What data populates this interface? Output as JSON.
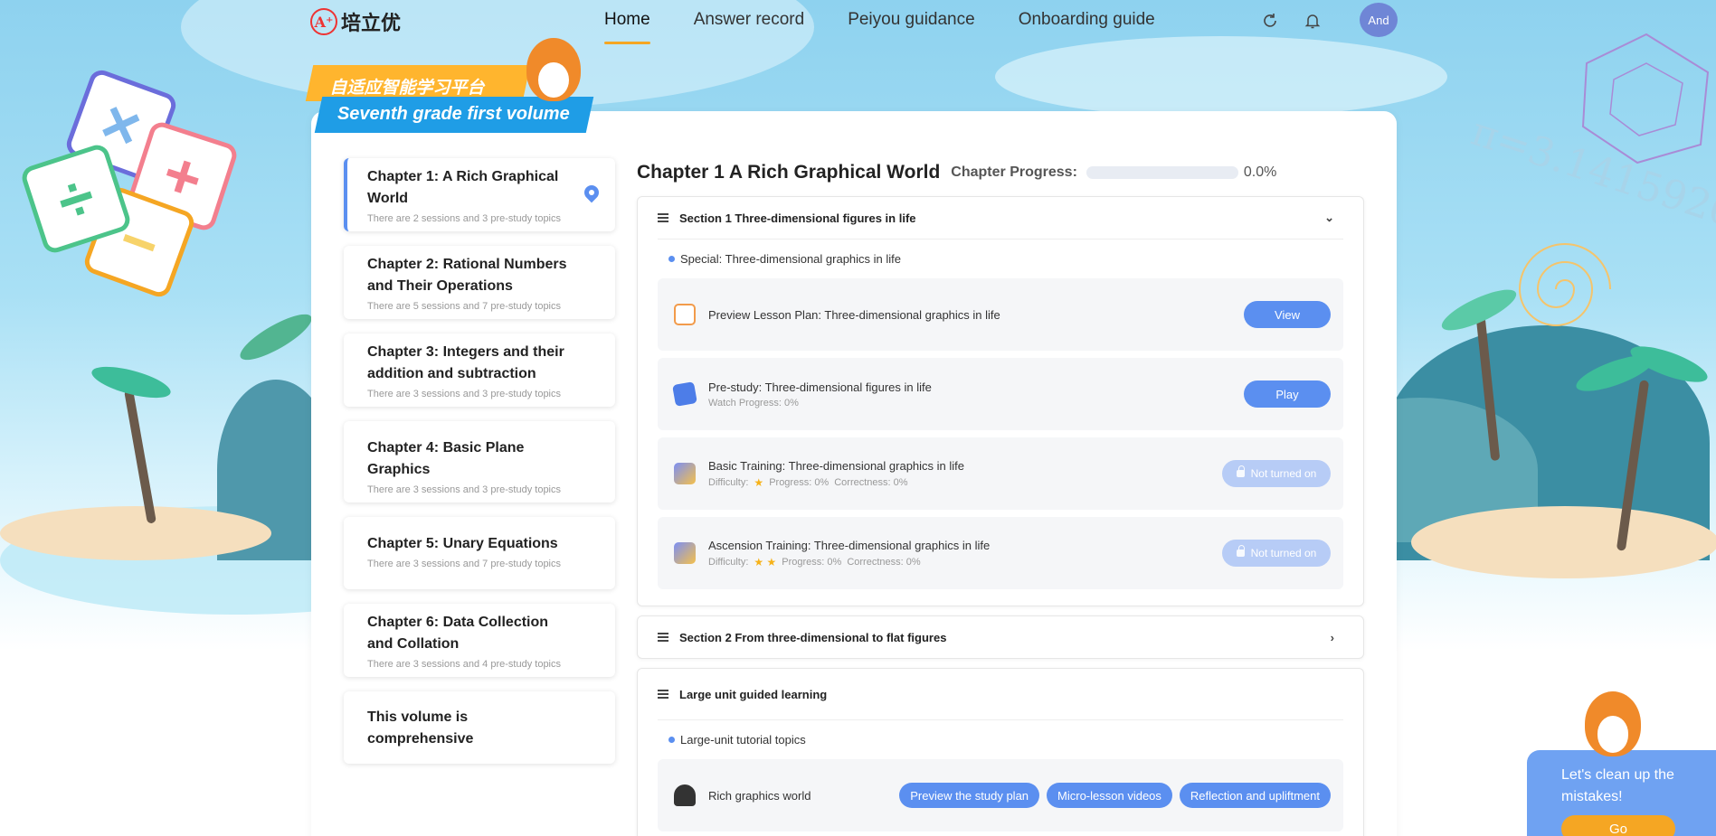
{
  "nav": {
    "logo_text": "培立优",
    "logo_mark": "A⁺",
    "links": [
      "Home",
      "Answer record",
      "Peiyou guidance",
      "Onboarding guide"
    ],
    "active_index": 0,
    "avatar": "And"
  },
  "banner": {
    "platform": "自适应智能学习平台",
    "grade": "Seventh grade  first volume"
  },
  "chapters": [
    {
      "title": "Chapter 1: A Rich Graphical World",
      "sub": "There are 2 sessions and 3 pre-study topics",
      "selected": true
    },
    {
      "title": "Chapter 2: Rational Numbers and Their Operations",
      "sub": "There are 5 sessions and 7 pre-study topics"
    },
    {
      "title": "Chapter 3: Integers and their addition and subtraction",
      "sub": "There are 3 sessions and 3 pre-study topics"
    },
    {
      "title": "Chapter 4: Basic Plane Graphics",
      "sub": "There are 3 sessions and 3 pre-study topics"
    },
    {
      "title": "Chapter 5: Unary Equations",
      "sub": "There are 3 sessions and 7 pre-study topics"
    },
    {
      "title": "Chapter 6: Data Collection and Collation",
      "sub": "There are 3 sessions and 4 pre-study topics"
    },
    {
      "title": "This volume is comprehensive",
      "sub": ""
    }
  ],
  "main": {
    "title": "Chapter 1 A Rich Graphical World",
    "progress_label": "Chapter Progress:",
    "progress_value": "0.0%",
    "progress_fraction": 0.0,
    "section1": {
      "title": "Section 1 Three-dimensional figures in life",
      "topic": "Special: Three-dimensional graphics in life",
      "items": [
        {
          "title": "Preview Lesson Plan: Three-dimensional graphics in life",
          "action": "View"
        },
        {
          "title": "Pre-study: Three-dimensional figures in life",
          "meta": "Watch Progress: 0%",
          "action": "Play"
        },
        {
          "title": "Basic Training: Three-dimensional graphics in life",
          "difficulty_label": "Difficulty:",
          "stars": "★",
          "progress": "Progress: 0%",
          "correctness": "Correctness: 0%",
          "action": "Not turned on"
        },
        {
          "title": "Ascension Training: Three-dimensional graphics in life",
          "difficulty_label": "Difficulty:",
          "stars": "★ ★",
          "progress": "Progress: 0%",
          "correctness": "Correctness: 0%",
          "action": "Not turned on"
        }
      ]
    },
    "section2": {
      "title": "Section 2 From three-dimensional to flat figures"
    },
    "section3": {
      "title": "Large unit guided learning",
      "topic": "Large-unit tutorial topics",
      "item_title": "Rich graphics world",
      "pills": [
        "Preview the study plan",
        "Micro-lesson videos",
        "Reflection and upliftment"
      ]
    }
  },
  "widget": {
    "text": "Let's clean up the mistakes!",
    "button": "Go"
  },
  "decor": {
    "pi_text": "π=3.14159265",
    "spiral_text": "3589793238462643383279502884197169"
  },
  "colors": {
    "accent": "#5b8ff0",
    "orange": "#f5a623",
    "banner_blue": "#1f9de6",
    "banner_orange": "#ffb52e"
  }
}
